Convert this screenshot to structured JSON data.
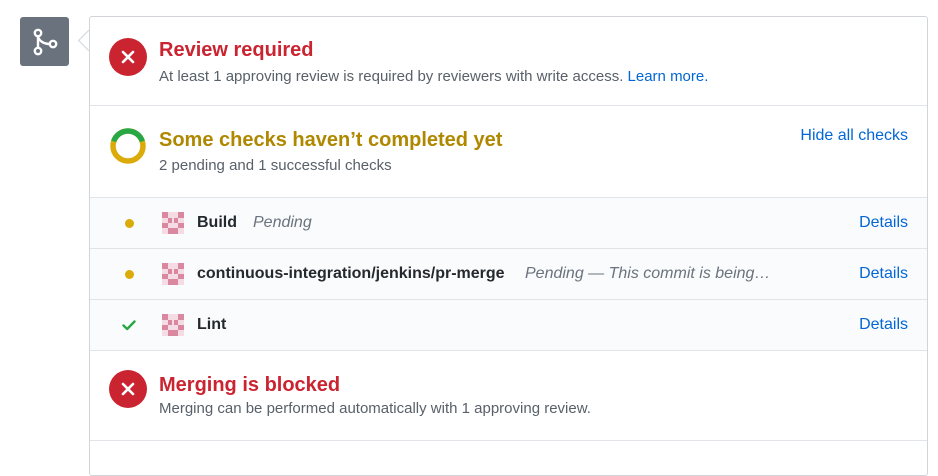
{
  "merge_icon": {
    "name": "git-merge-icon"
  },
  "review": {
    "icon": "x-icon",
    "title": "Review required",
    "description": "At least 1 approving review is required by reviewers with write access.",
    "link": "Learn more."
  },
  "checks": {
    "icon": "donut-status-icon",
    "title": "Some checks haven’t completed yet",
    "description": "2 pending and 1 successful checks",
    "toggle_link": "Hide all checks",
    "items": [
      {
        "status": "pending",
        "name": "Build",
        "message": "Pending",
        "details": "Details"
      },
      {
        "status": "pending",
        "name": "continuous-integration/jenkins/pr-merge",
        "message": "Pending — This commit is being…",
        "details": "Details"
      },
      {
        "status": "success",
        "name": "Lint",
        "message": "",
        "details": "Details"
      }
    ]
  },
  "blocked": {
    "icon": "x-icon",
    "title": "Merging is blocked",
    "description": "Merging can be performed automatically with 1 approving review."
  },
  "colors": {
    "fail": "#cb2431",
    "pending": "#dbab09",
    "success": "#28a745",
    "link": "#0366d6",
    "pending_title": "#b08800"
  }
}
